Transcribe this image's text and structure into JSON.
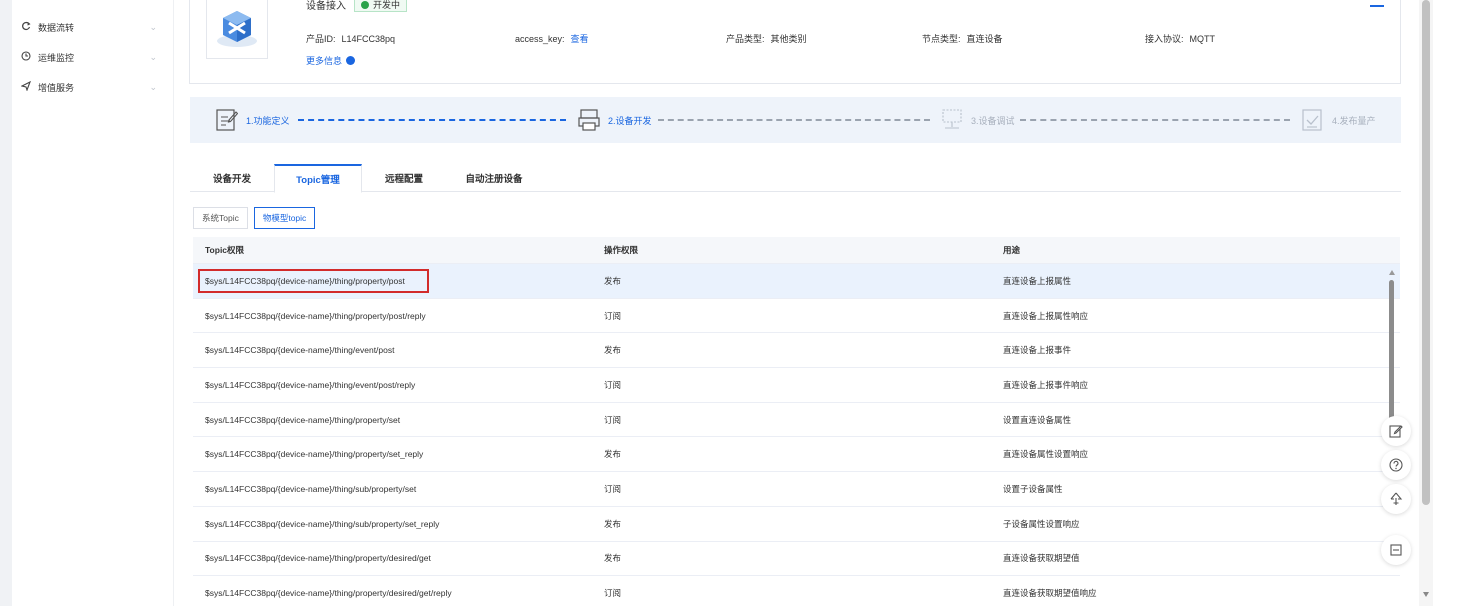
{
  "sidebar": {
    "items": [
      {
        "icon": "data-flow-icon",
        "label": "数据流转"
      },
      {
        "icon": "monitor-icon",
        "label": "运维监控"
      },
      {
        "icon": "send-icon",
        "label": "增值服务"
      }
    ]
  },
  "product": {
    "title": "设备接入",
    "status": "开发中",
    "product_id_label": "产品ID:",
    "product_id": "L14FCC38pq",
    "access_key_label": "access_key:",
    "access_key_link": "查看",
    "product_type_label": "产品类型:",
    "product_type": "其他类别",
    "node_type_label": "节点类型:",
    "node_type": "直连设备",
    "protocol_label": "接入协议:",
    "protocol": "MQTT",
    "more_info": "更多信息"
  },
  "steps": [
    {
      "label": "1.功能定义",
      "state": "done"
    },
    {
      "label": "2.设备开发",
      "state": "done"
    },
    {
      "label": "3.设备调试",
      "state": "pending"
    },
    {
      "label": "4.发布量产",
      "state": "pending"
    }
  ],
  "tabs": [
    {
      "label": "设备开发"
    },
    {
      "label": "Topic管理"
    },
    {
      "label": "远程配置"
    },
    {
      "label": "自动注册设备"
    }
  ],
  "active_tab": "Topic管理",
  "subtabs": [
    {
      "label": "系统Topic"
    },
    {
      "label": "物模型topic"
    }
  ],
  "active_subtab": "物模型topic",
  "table": {
    "headers": [
      "Topic权限",
      "操作权限",
      "用途"
    ],
    "rows": [
      [
        "$sys/L14FCC38pq/{device-name}/thing/property/post",
        "发布",
        "直连设备上报属性"
      ],
      [
        "$sys/L14FCC38pq/{device-name}/thing/property/post/reply",
        "订阅",
        "直连设备上报属性响应"
      ],
      [
        "$sys/L14FCC38pq/{device-name}/thing/event/post",
        "发布",
        "直连设备上报事件"
      ],
      [
        "$sys/L14FCC38pq/{device-name}/thing/event/post/reply",
        "订阅",
        "直连设备上报事件响应"
      ],
      [
        "$sys/L14FCC38pq/{device-name}/thing/property/set",
        "订阅",
        "设置直连设备属性"
      ],
      [
        "$sys/L14FCC38pq/{device-name}/thing/property/set_reply",
        "发布",
        "直连设备属性设置响应"
      ],
      [
        "$sys/L14FCC38pq/{device-name}/thing/sub/property/set",
        "订阅",
        "设置子设备属性"
      ],
      [
        "$sys/L14FCC38pq/{device-name}/thing/sub/property/set_reply",
        "发布",
        "子设备属性设置响应"
      ],
      [
        "$sys/L14FCC38pq/{device-name}/thing/property/desired/get",
        "发布",
        "直连设备获取期望值"
      ],
      [
        "$sys/L14FCC38pq/{device-name}/thing/property/desired/get/reply",
        "订阅",
        "直连设备获取期望值响应"
      ]
    ]
  },
  "float_tools": [
    "edit-icon",
    "help-icon",
    "upload-icon",
    "collapse-icon"
  ],
  "colors": {
    "accent": "#1a66e0",
    "highlight": "#d22b2b",
    "selected_row": "#eaf2fd",
    "status_green": "#2aa34a"
  }
}
